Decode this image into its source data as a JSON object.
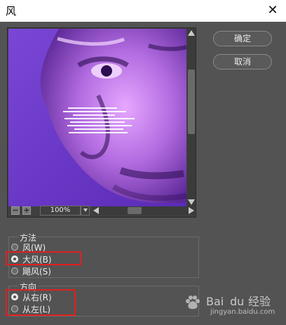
{
  "window": {
    "title": "风"
  },
  "buttons": {
    "ok_label": "确定",
    "cancel_label": "取消"
  },
  "zoom": {
    "value": "100%"
  },
  "method": {
    "label": "方法",
    "options": [
      {
        "label": "风(W)",
        "selected": false
      },
      {
        "label": "大风(B)",
        "selected": true
      },
      {
        "label": "飓风(S)",
        "selected": false
      }
    ]
  },
  "direction": {
    "label": "方向",
    "options": [
      {
        "label": "从右(R)",
        "selected": true
      },
      {
        "label": "从左(L)",
        "selected": false
      }
    ]
  },
  "watermark": {
    "logo_text": "Bai du 经验",
    "url": "jingyan.baidu.com"
  },
  "colors": {
    "highlight": "#e21f1f",
    "preview_purple": "#7f42d6"
  },
  "icons": [
    "close-icon",
    "scroll-up-icon",
    "scroll-down-icon",
    "zoom-out-icon",
    "zoom-in-icon",
    "chevron-down-icon",
    "scroll-left-icon",
    "scroll-right-icon"
  ]
}
